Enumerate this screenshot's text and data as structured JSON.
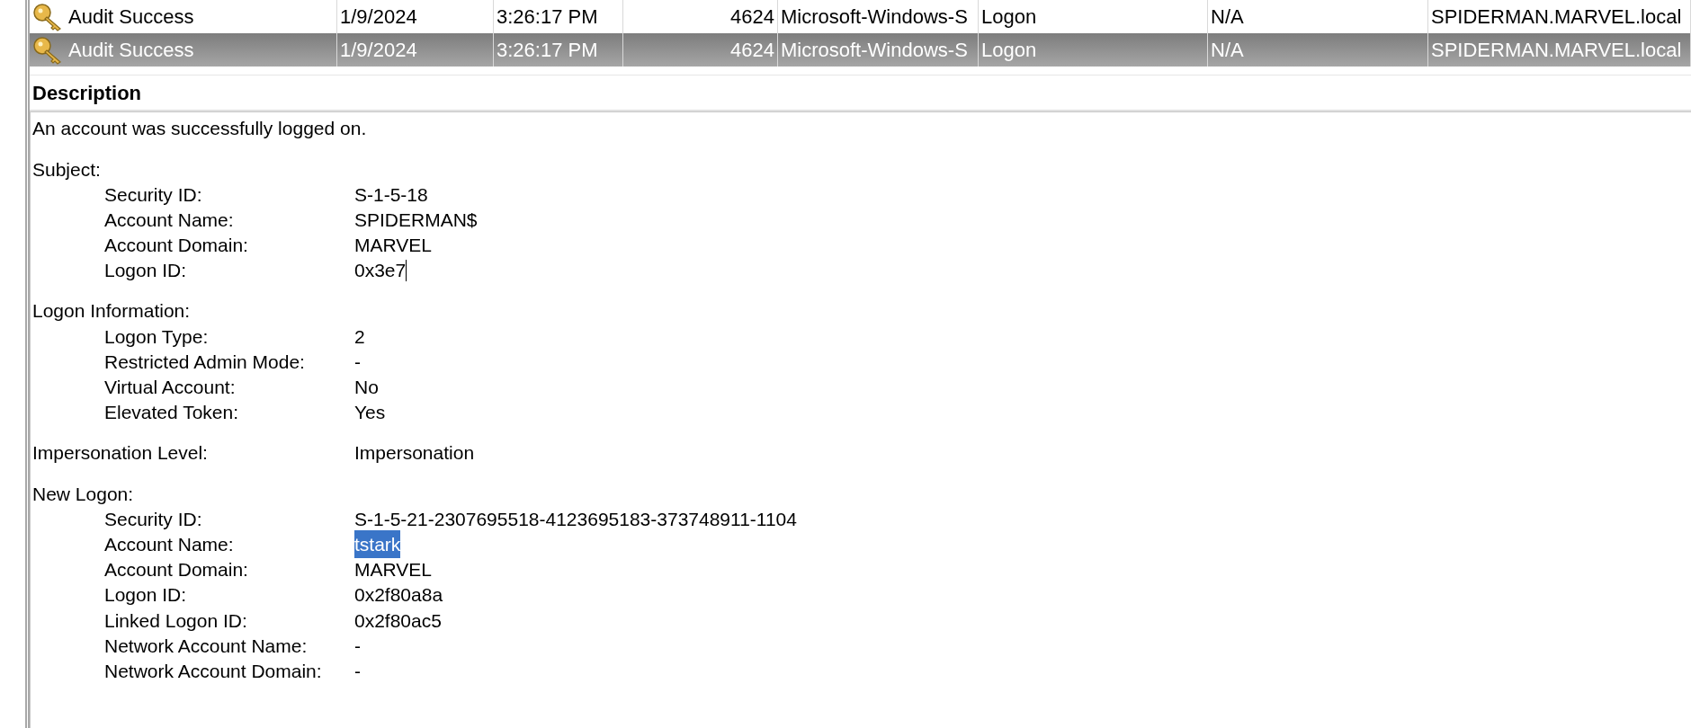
{
  "events": {
    "rows": [
      {
        "selected": false,
        "cells": [
          "Audit Success",
          "1/9/2024",
          "3:26:17 PM",
          "4624",
          "Microsoft-Windows-S",
          "Logon",
          "N/A",
          "SPIDERMAN.MARVEL.local"
        ]
      },
      {
        "selected": true,
        "cells": [
          "Audit Success",
          "1/9/2024",
          "3:26:17 PM",
          "4624",
          "Microsoft-Windows-S",
          "Logon",
          "N/A",
          "SPIDERMAN.MARVEL.local"
        ]
      }
    ]
  },
  "description": {
    "title": "Description",
    "blocks": [
      {
        "kind": "text",
        "text": "An account was successfully logged on."
      },
      {
        "kind": "group",
        "title": "Subject:",
        "fields": [
          {
            "label": "Security ID:",
            "value": "S-1-5-18",
            "highlighted": false,
            "cursor": false
          },
          {
            "label": "Account Name:",
            "value": "SPIDERMAN$",
            "highlighted": false,
            "cursor": false
          },
          {
            "label": "Account Domain:",
            "value": "MARVEL",
            "highlighted": false,
            "cursor": false
          },
          {
            "label": "Logon ID:",
            "value": "0x3e7",
            "highlighted": false,
            "cursor": true
          }
        ]
      },
      {
        "kind": "group",
        "title": "Logon Information:",
        "fields": [
          {
            "label": "Logon Type:",
            "value": "2",
            "highlighted": false,
            "cursor": false
          },
          {
            "label": "Restricted Admin Mode:",
            "value": "-",
            "highlighted": false,
            "cursor": false
          },
          {
            "label": "Virtual Account:",
            "value": "No",
            "highlighted": false,
            "cursor": false
          },
          {
            "label": "Elevated Token:",
            "value": "Yes",
            "highlighted": false,
            "cursor": false
          }
        ]
      },
      {
        "kind": "field",
        "label": "Impersonation Level:",
        "value": "Impersonation"
      },
      {
        "kind": "group",
        "title": "New Logon:",
        "fields": [
          {
            "label": "Security ID:",
            "value": "S-1-5-21-2307695518-4123695183-373748911-1104",
            "highlighted": false,
            "cursor": false
          },
          {
            "label": "Account Name:",
            "value": "tstark",
            "highlighted": true,
            "cursor": false
          },
          {
            "label": "Account Domain:",
            "value": "MARVEL",
            "highlighted": false,
            "cursor": false
          },
          {
            "label": "Logon ID:",
            "value": "0x2f80a8a",
            "highlighted": false,
            "cursor": false
          },
          {
            "label": "Linked Logon ID:",
            "value": "0x2f80ac5",
            "highlighted": false,
            "cursor": false
          },
          {
            "label": "Network Account Name:",
            "value": "-",
            "highlighted": false,
            "cursor": false
          },
          {
            "label": "Network Account Domain:",
            "value": "-",
            "highlighted": false,
            "cursor": false
          }
        ]
      }
    ]
  }
}
